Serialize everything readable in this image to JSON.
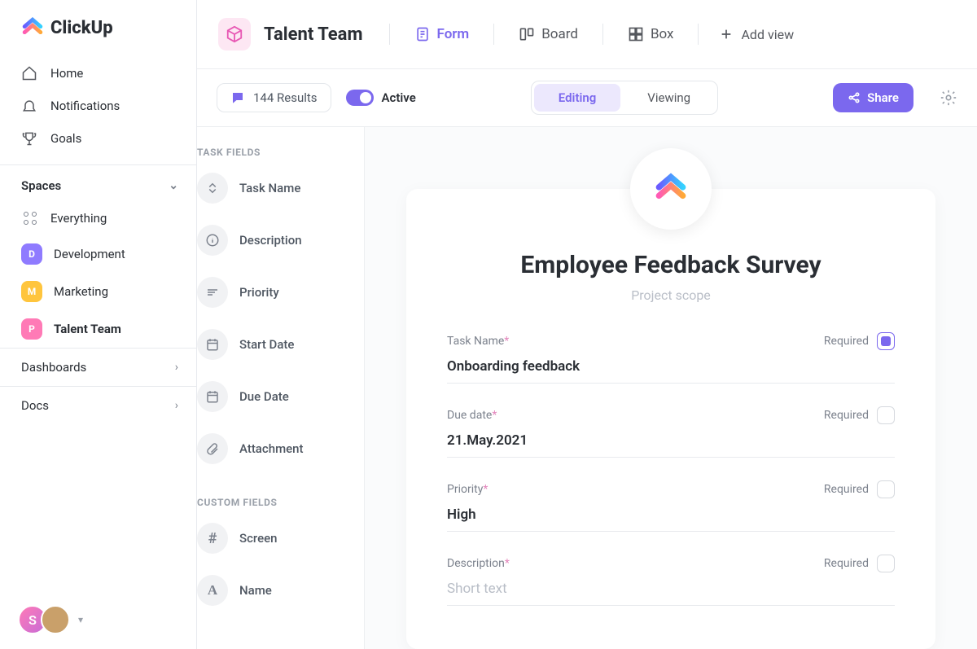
{
  "brand": "ClickUp",
  "sidebar": {
    "nav": [
      {
        "label": "Home"
      },
      {
        "label": "Notifications"
      },
      {
        "label": "Goals"
      }
    ],
    "spaces_header": "Spaces",
    "everything": "Everything",
    "spaces": [
      {
        "label": "Development",
        "letter": "D",
        "color": "#8f7bff"
      },
      {
        "label": "Marketing",
        "letter": "M",
        "color": "#ffc53d"
      },
      {
        "label": "Talent Team",
        "letter": "P",
        "color": "#ff7ab6"
      }
    ],
    "dashboards": "Dashboards",
    "docs": "Docs",
    "avatar_letter": "S"
  },
  "topbar": {
    "title": "Talent Team",
    "views": [
      {
        "label": "Form",
        "active": true
      },
      {
        "label": "Board"
      },
      {
        "label": "Box"
      }
    ],
    "add_view": "Add view"
  },
  "subbar": {
    "results": "144 Results",
    "active": "Active",
    "editing": "Editing",
    "viewing": "Viewing",
    "share": "Share"
  },
  "fields_panel": {
    "task_fields_label": "TASK FIELDS",
    "task_fields": [
      {
        "label": "Task Name",
        "icon": "sort"
      },
      {
        "label": "Description",
        "icon": "info"
      },
      {
        "label": "Priority",
        "icon": "priority"
      },
      {
        "label": "Start Date",
        "icon": "calendar"
      },
      {
        "label": "Due Date",
        "icon": "calendar"
      },
      {
        "label": "Attachment",
        "icon": "attach"
      }
    ],
    "custom_fields_label": "CUSTOM FIELDS",
    "custom_fields": [
      {
        "label": "Screen",
        "icon": "hash"
      },
      {
        "label": "Name",
        "icon": "letter"
      }
    ]
  },
  "form": {
    "title": "Employee Feedback Survey",
    "subtitle": "Project scope",
    "required_label": "Required",
    "fields": [
      {
        "label": "Task Name",
        "value": "Onboarding feedback",
        "required": true
      },
      {
        "label": "Due date",
        "value": "21.May.2021",
        "required": false
      },
      {
        "label": "Priority",
        "value": "High",
        "required": false
      },
      {
        "label": "Description",
        "value": "",
        "placeholder": "Short text",
        "required": false
      }
    ]
  }
}
